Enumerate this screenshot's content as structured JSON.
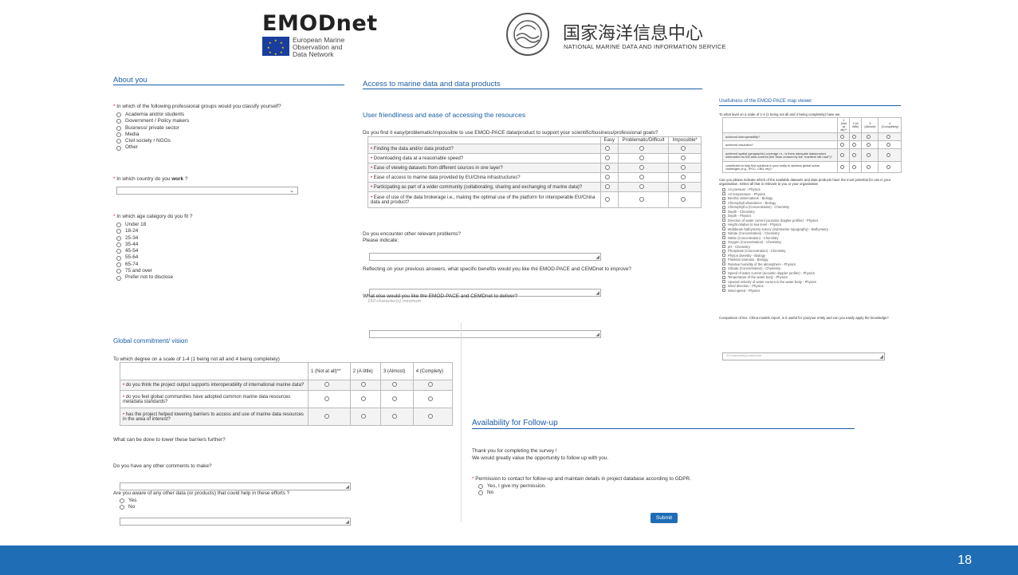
{
  "header": {
    "emodnet_title": "EMODnet",
    "emodnet_sub": [
      "European Marine",
      "Observation and",
      "Data Network"
    ],
    "nmdis_title": "国家海洋信息中心",
    "nmdis_sub": "NATIONAL MARINE DATA AND INFORMATION SERVICE"
  },
  "about": {
    "title": "About you",
    "q_group": "In which of the following professional groups would you classify yourself?",
    "groups": [
      "Academia and/or students",
      "Government / Policy makers",
      "Business/ private sector",
      "Media",
      "Civil society / NGOs",
      "Other"
    ],
    "q_country_pre": "In which country do you ",
    "q_country_bold": "work",
    "q_country_post": " ?",
    "q_age": "In which age category do you fit ?",
    "ages": [
      "Under 18",
      "18-24",
      "25-34",
      "35-44",
      "45-54",
      "55-64",
      "65-74",
      "75 and over",
      "Prefer not to disclose"
    ]
  },
  "access": {
    "title": "Access to marine data and data products",
    "subtitle": "User friendliness and ease of accessing the resources",
    "question": "Do you find it easy/problematic/impossible to use EMOD-PACE data/product to support your scientific/business/professional goals?",
    "columns": [
      "Easy",
      "Problematic/Difficult",
      "Impossible*"
    ],
    "rows": [
      "Finding the data and/or data product?",
      "Downloading data at a reasonable speed?",
      "Ease of viewing datasets from different sources in one layer?",
      "Ease of access to marine data provided by EU/China infrastructures?",
      "Participating as part of a wider community (collaborating, sharing and exchanging of marine data)?",
      "Ease of use of the data brokerage i.e., making the optimal use of the platform for interoperable EU/China data and product?"
    ],
    "q_problems": "Do you encounter other relevant problems?",
    "q_problems_sub": "Please indicate:",
    "q_benefits": "Reflecting on your previous answers, what specific benefits would you like the EMOD-PACE and CEMDnet to improve?",
    "q_deliver": "What else would you like the EMOD-PACE and CEMDnet to deliver?",
    "deliver_placeholder": "150 character(s) minimum"
  },
  "viewer": {
    "title": "Usefulness of the EMOD-PACE map viewer",
    "question": "To what level on a scale of 1-4 (1 being not all and 4 being completely) have we:",
    "columns": [
      "1 (Not at all)**",
      "2 (A little)",
      "3 (Almost)",
      "4 (Completely)"
    ],
    "rows": [
      "achieved interoperability?",
      "achieved resolution?",
      "achieved spatial (geographic) coverage i.e., is there adequate data/product information for the area covered (the Seas crossed by the \"maritime silk road\")?",
      "contributed to help find solutions in your entity to address global ocean challenges (e.g., IPCC, CBD, etc)?"
    ],
    "q_datasets": "Can you please indicate which of the available datasets and data products have the most potential for use in your organisation. Select all that is relevant to you or your organisation",
    "datasets": [
      "Air pressure - Physics",
      "Air temperature - Physics",
      "Benthic observations - Biology",
      "Chlorophyll abundance - Biology",
      "Chlorophyll-a (Concentration) - Chemistry",
      "Depth - Chemistry",
      "Depth - Physics",
      "Direction of water current (acoustic doppler profiler) - Physics",
      "Height relative to sea level - Physics",
      "Multibeam bathymetry survey (Submarine topography) - Bathymetry",
      "Nitrate (Concentration) - Chemistry",
      "Nitrite (Concentration) - Chemistry",
      "Oxygen (Concentration) - Chemistry",
      "pH - Chemistry",
      "Phosphate (Concentration) - Chemistry",
      "Phyton diversity - Biology",
      "Plankton biomass - Biology",
      "Relative humidity of the atmosphere - Physics",
      "Silicate (Concentration) - Chemistry",
      "Speed of water current (acoustic doppler profiler) - Physics",
      "Temperature of the water body - Physics",
      "Upward velocity of water current in the water body - Physics",
      "Wind direction - Physics",
      "Wind speed - Physics"
    ],
    "q_comparison": "Comparison of EU- China models report, is it useful for you/your entity and can you easily apply the knowledge?",
    "comparison_placeholder": "10 character(s) minimum"
  },
  "global": {
    "title": "Global commitment/ vision",
    "question": "To which degree on a scale of 1-4 (1 being not all and 4 being completely)",
    "columns": [
      "1 (Not at all)**",
      "2 (A little)",
      "3 (Almost)",
      "4 (Complety)"
    ],
    "rows": [
      "do you think the project output supports interoperability of international marine data?",
      "do you feel global communities have adopted common marine data resources metadata standards?",
      "has the project helped lowering barriers to access and use of marine data resources in the area of interest?"
    ],
    "q_barriers": "What can be done to lower these barriers further?",
    "q_comments": "Do you have any other comments to make?",
    "q_aware": "Are you aware of any other data (or products) that could help in these efforts ?",
    "yes": "Yes",
    "no": "No"
  },
  "followup": {
    "title": "Availability for Follow-up",
    "thanks": "Thank you for completing the survey !",
    "value": "We would greatly value the opportunity to follow up with you.",
    "q_permission": "Permission to contact for follow-up and maintain details in project database according to GDPR.",
    "opt_yes": "Yes, I give my permission.",
    "opt_no": "No",
    "submit": "Submit"
  },
  "page_number": "18",
  "colors": {
    "accent": "#1b5da8",
    "footer": "#1f6db5",
    "required": "#dd2222"
  }
}
